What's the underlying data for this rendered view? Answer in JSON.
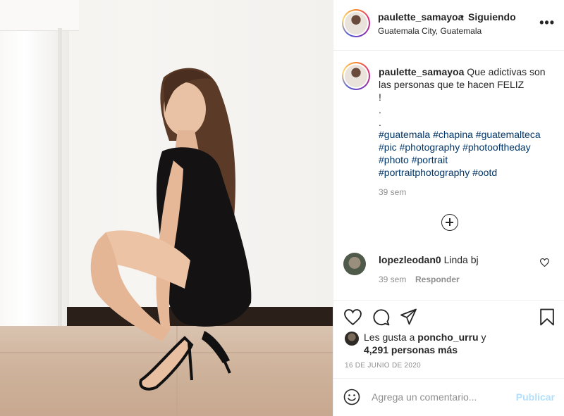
{
  "post": {
    "header": {
      "username": "paulette_samayoa",
      "separator": "•",
      "follow_status": "Siguiendo",
      "location": "Guatemala City, Guatemala",
      "more_label": "..."
    },
    "caption": {
      "username": "paulette_samayoa",
      "text": "Que adictivas son las personas que te hacen FELIZ",
      "lines_after": [
        "!",
        ".",
        "."
      ],
      "hashtags": [
        "#guatemala",
        "#chapina",
        "#guatemalteca",
        "#pic",
        "#photography",
        "#photooftheday",
        "#photo",
        "#portrait",
        "#portraitphotography",
        "#ootd"
      ],
      "time": "39 sem"
    },
    "comments": [
      {
        "username": "lopezleodan0",
        "text": "Linda bj",
        "time": "39 sem",
        "reply_label": "Responder"
      }
    ],
    "likes": {
      "prefix": "Les gusta a",
      "liker": "poncho_urru",
      "conjunction": "y",
      "count_text": "4,291 personas más"
    },
    "date": "16 DE JUNIO DE 2020",
    "add_comment": {
      "placeholder": "Agrega un comentario...",
      "post_label": "Publicar"
    },
    "icons": {
      "like": "heart-icon",
      "comment": "comment-icon",
      "share": "share-icon",
      "save": "bookmark-icon",
      "emoji": "emoji-icon",
      "load_more": "plus-circle-icon"
    },
    "colors": {
      "hashtag": "#00376b",
      "muted": "#8e8e8e",
      "publish_disabled": "#b2dffc"
    }
  }
}
